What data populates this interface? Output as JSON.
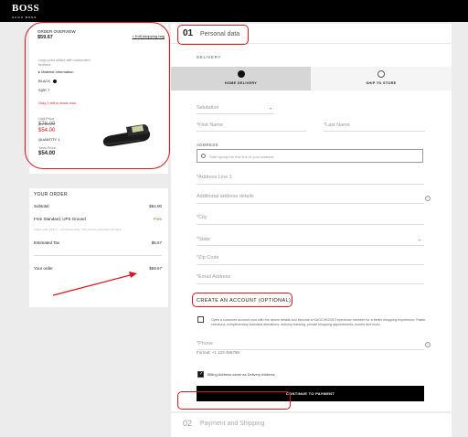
{
  "brand": {
    "name": "BOSS",
    "tagline": "HUGO BOSS"
  },
  "order_overview": {
    "label": "ORDER OVERVIEW",
    "total": "$59.67",
    "edit_link": "< Edit shopping bag",
    "product_name": "Logo-print slides with contoured footbed",
    "material": "Material Information",
    "color": "BLACK",
    "size": "SIZE 7",
    "stock": "Only 2 left in stock now",
    "unit_price_label": "Unit Price",
    "old_price": "$78.00",
    "new_price": "$54.00",
    "quantity": "QUANTITY 1",
    "total_price_label": "Total Price",
    "total_price": "$54.00"
  },
  "your_order": {
    "title": "YOUR ORDER",
    "subtotal_label": "Subtotal",
    "subtotal": "$54.00",
    "shipping_label": "Free Standard, UPS Ground",
    "shipping": "Free",
    "shipping_note": "Orders with within 1 - 3 business days. This process extended to 5 days.",
    "tax_label": "Estimated Tax",
    "tax": "$5.67",
    "order_label": "Your order",
    "order_total": "$59.67"
  },
  "section1": {
    "number": "01",
    "title": "Personal data",
    "delivery_label": "DELIVERY",
    "tabs": [
      "HOME DELIVERY",
      "SHIP TO STORE"
    ],
    "salutation": "Salutation",
    "first_name": "*First Name",
    "last_name": "*Last Name",
    "address_label": "ADDRESS",
    "address_search_placeholder": "Start typing the first line of your address",
    "address1": "*Address Line 1",
    "address2": "Additional address details",
    "city": "*City",
    "state": "*State",
    "zip": "*Zip Code",
    "email": "*Email Address",
    "create_account": "CREATE AN ACCOUNT (OPTIONAL)",
    "consent": "Open a customer account now with the above details and become a HUGO BOSS Experience member for a better shopping experience: Faster checkout, complimentary standard alterations, delivery tracking, private shopping appointments, events and more.",
    "phone": "*Phone",
    "phone_format": "Format: +1 123 456789",
    "billing_same": "Billing Address same as Delivery Address",
    "continue_button": "CONTINUE TO PAYMENT"
  },
  "section2": {
    "number": "02",
    "title": "Payment and Shipping"
  },
  "colors": {
    "annotation": "#d8161c",
    "accent": "#000000"
  }
}
